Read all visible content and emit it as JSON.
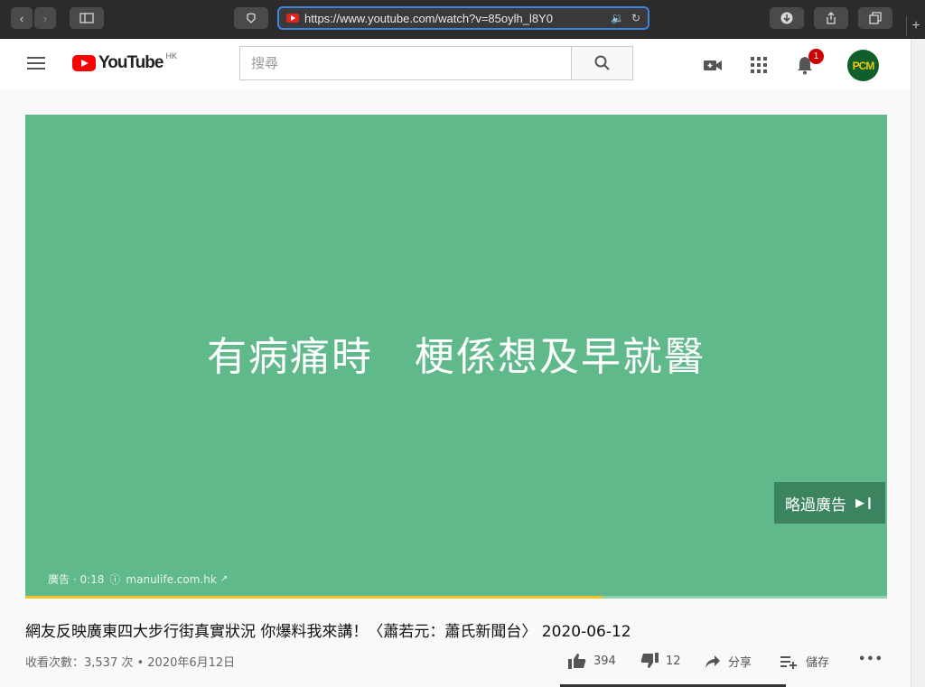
{
  "browser": {
    "url": "https://www.youtube.com/watch?v=85oylh_l8Y0"
  },
  "header": {
    "logo_text": "YouTube",
    "region": "HK",
    "search_placeholder": "搜尋",
    "notification_count": "1",
    "avatar_text": "PCM"
  },
  "player": {
    "ad_caption": "有病痛時　梗係想及早就醫",
    "skip_label": "略過廣告",
    "ad_label": "廣告 · 0:18",
    "ad_domain": "manulife.com.hk",
    "progress": 0.67
  },
  "video": {
    "title": "網友反映廣東四大步行街真實狀況 你爆料我來講！〈蕭若元：蕭氏新聞台〉 2020-06-12",
    "meta": "收看次數：3,537 次 • 2020年6月12日",
    "likes": "394",
    "dislikes": "12",
    "share_label": "分享",
    "save_label": "儲存",
    "more_label": "•••"
  },
  "colors": {
    "player_bg": "#5fb98b",
    "progress_fill": "#f3c325",
    "brand_red": "#ff0000"
  }
}
